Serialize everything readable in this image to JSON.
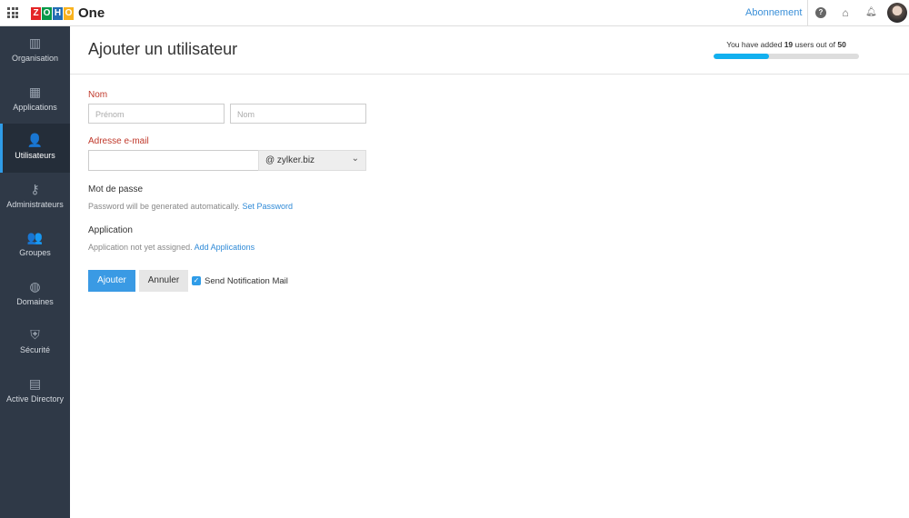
{
  "header": {
    "brand_letters": [
      "Z",
      "O",
      "H",
      "O"
    ],
    "brand_colors": [
      "#e42527",
      "#089949",
      "#226db4",
      "#f9b21d"
    ],
    "product": "One",
    "subscription_link": "Abonnement"
  },
  "sidebar": {
    "items": [
      {
        "label": "Organisation",
        "icon": "building-icon",
        "glyph": "▥"
      },
      {
        "label": "Applications",
        "icon": "apps-grid-icon",
        "glyph": "▦"
      },
      {
        "label": "Utilisateurs",
        "icon": "user-icon",
        "glyph": "👤"
      },
      {
        "label": "Administrateurs",
        "icon": "admin-key-icon",
        "glyph": "⚷"
      },
      {
        "label": "Groupes",
        "icon": "group-icon",
        "glyph": "👥"
      },
      {
        "label": "Domaines",
        "icon": "globe-icon",
        "glyph": "◍"
      },
      {
        "label": "Sécurité",
        "icon": "shield-icon",
        "glyph": "⛨"
      },
      {
        "label": "Active Directory",
        "icon": "directory-sync-icon",
        "glyph": "▤"
      }
    ],
    "active": "Utilisateurs"
  },
  "page": {
    "title": "Ajouter un utilisateur",
    "usage": {
      "prefix": "You have added",
      "count": "19",
      "middle": "users out of",
      "total": "50",
      "fraction": 0.38
    }
  },
  "form": {
    "name_label": "Nom",
    "first_name_placeholder": "Prénom",
    "last_name_placeholder": "Nom",
    "email_label": "Adresse e-mail",
    "email_value": "",
    "domain": "@ zylker.biz",
    "password_label": "Mot de passe",
    "password_hint": "Password will be generated automatically.",
    "set_password_link": "Set Password",
    "application_label": "Application",
    "application_hint": "Application not yet assigned.",
    "add_applications_link": "Add Applications",
    "submit": "Ajouter",
    "cancel": "Annuler",
    "notify_label": "Send Notification Mail",
    "notify_checked": true
  }
}
